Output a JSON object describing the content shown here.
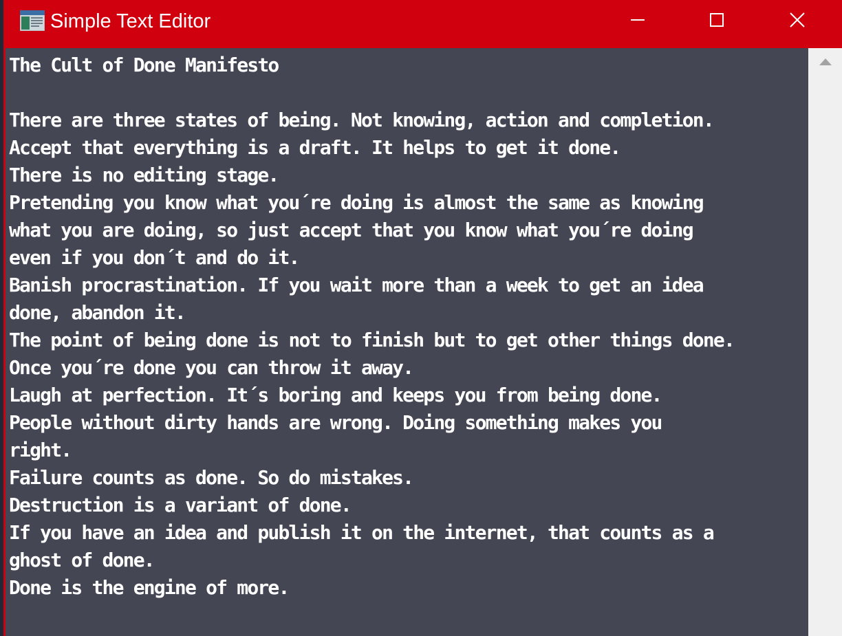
{
  "window": {
    "title": "Simple Text Editor",
    "icon": "notepad-app-icon",
    "controls": {
      "minimize_icon": "minimize-icon",
      "maximize_icon": "maximize-icon",
      "close_icon": "close-icon"
    },
    "colors": {
      "titlebar": "#d1000f",
      "editor_background": "#454653",
      "editor_text": "#ffffff",
      "scrollbar": "#f0f0f0"
    }
  },
  "editor": {
    "lines": [
      "The Cult of Done Manifesto",
      "",
      "There are three states of being. Not knowing, action and completion.",
      "Accept that everything is a draft. It helps to get it done.",
      "There is no editing stage.",
      "Pretending you know what you´re doing is almost the same as knowing",
      "what you are doing, so just accept that you know what you´re doing",
      "even if you don´t and do it.",
      "Banish procrastination. If you wait more than a week to get an idea",
      "done, abandon it.",
      "The point of being done is not to finish but to get other things done.",
      "Once you´re done you can throw it away.",
      "Laugh at perfection. It´s boring and keeps you from being done.",
      "People without dirty hands are wrong. Doing something makes you",
      "right.",
      "Failure counts as done. So do mistakes.",
      "Destruction is a variant of done.",
      "If you have an idea and publish it on the internet, that counts as a",
      "ghost of done.",
      "Done is the engine of more."
    ]
  },
  "scrollbar": {
    "up_icon": "scroll-up-arrow-icon"
  }
}
